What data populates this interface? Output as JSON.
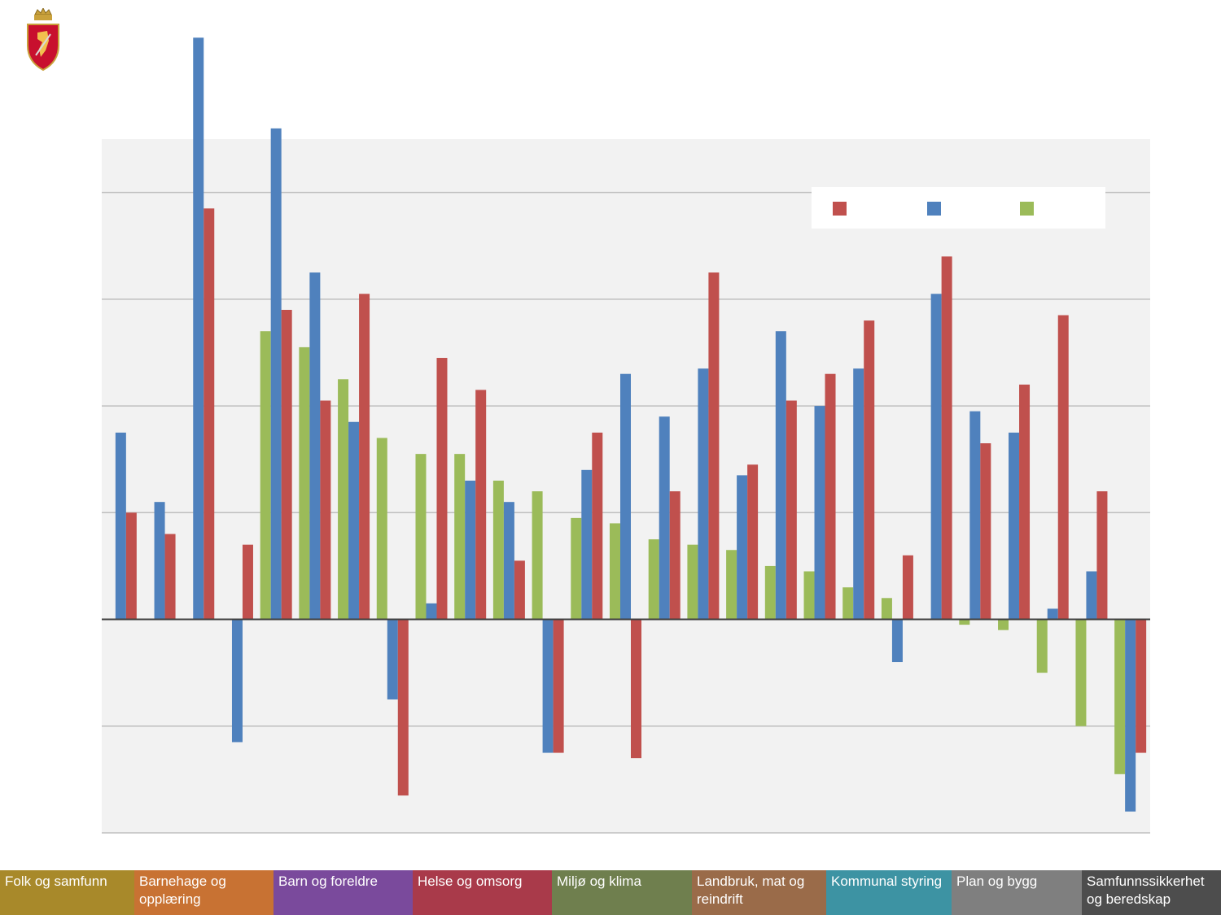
{
  "footer": {
    "categories": [
      {
        "label": "Folk og samfunn",
        "color": "#a8892a"
      },
      {
        "label": "Barnehage og opplæring",
        "color": "#c87233"
      },
      {
        "label": "Barn og foreldre",
        "color": "#7a4a9c"
      },
      {
        "label": "Helse og omsorg",
        "color": "#a93a4a"
      },
      {
        "label": "Miljø og klima",
        "color": "#6f7f4e"
      },
      {
        "label": "Landbruk, mat og reindrift",
        "color": "#9a6b49"
      },
      {
        "label": "Kommunal styring",
        "color": "#3d93a3"
      },
      {
        "label": "Plan og bygg",
        "color": "#7f7f7f"
      },
      {
        "label": "Samfunnssikkerhet og beredskap",
        "color": "#4d4d4d"
      }
    ]
  },
  "chart_data": {
    "type": "bar",
    "grid": true,
    "ylim": [
      -4,
      9
    ],
    "series": [
      {
        "color": "#9bbb59",
        "values": [
          null,
          null,
          null,
          null,
          5.4,
          5.1,
          4.5,
          3.4,
          3.1,
          3.1,
          2.6,
          2.4,
          1.9,
          1.8,
          1.5,
          1.4,
          1.3,
          1.0,
          0.9,
          0.6,
          0.4,
          null,
          -0.1,
          -0.2,
          -1.0,
          -2.0,
          -2.9
        ]
      },
      {
        "color": "#4f81bd",
        "values": [
          3.5,
          2.2,
          10.9,
          -2.3,
          9.2,
          6.5,
          3.7,
          -1.5,
          0.3,
          2.6,
          2.2,
          -2.5,
          2.8,
          4.6,
          3.8,
          4.7,
          2.7,
          5.4,
          4.0,
          4.7,
          -0.8,
          6.1,
          3.9,
          3.5,
          0.2,
          0.9,
          -3.6
        ]
      },
      {
        "color": "#c0504d",
        "values": [
          2.0,
          1.6,
          7.7,
          1.4,
          5.8,
          4.1,
          6.1,
          -3.3,
          4.9,
          4.3,
          1.1,
          -2.5,
          3.5,
          -2.6,
          2.4,
          6.5,
          2.9,
          4.1,
          4.6,
          5.6,
          1.2,
          6.8,
          3.3,
          4.4,
          5.7,
          2.4,
          -2.5
        ]
      }
    ]
  }
}
